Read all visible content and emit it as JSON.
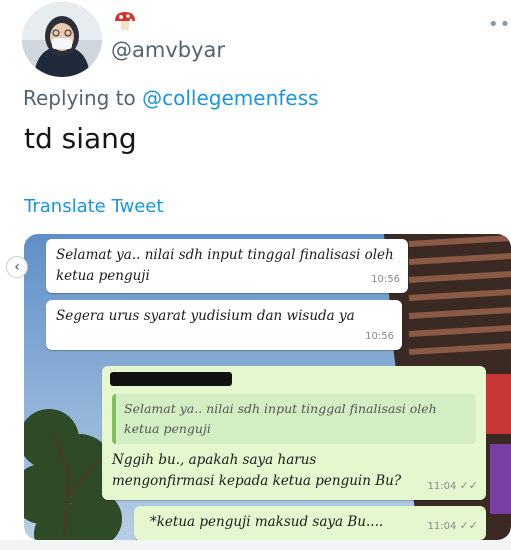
{
  "author": {
    "handle": "@amvbyar",
    "badge_icon": "mushroom-icon",
    "avatar_icon": "avatar"
  },
  "more_icon": "more-icon",
  "reply": {
    "prefix": "Replying to",
    "mention": "@collegemenfess"
  },
  "tweet_text": "td siang",
  "translate_label": "Translate Tweet",
  "chat": {
    "messages": [
      {
        "type": "incoming",
        "text": "Selamat ya.. nilai sdh input tinggal finalisasi oleh ketua penguji",
        "time": "10:56"
      },
      {
        "type": "incoming",
        "text": "Segera urus syarat yudisium dan wisuda ya",
        "time": "10:56"
      },
      {
        "type": "outgoing",
        "quote": "Selamat ya.. nilai sdh input tinggal finalisasi oleh ketua penguji",
        "text": "Nggih bu., apakah saya harus mengonfirmasi kepada ketua penguin Bu?",
        "time": "11:04"
      },
      {
        "type": "outgoing",
        "text": "*ketua penguji maksud saya Bu....",
        "time": "11:04"
      }
    ],
    "read_ticks": "✓✓"
  },
  "colors": {
    "link": "#1b95e0",
    "muted": "#536471",
    "outgoing_bubble": "#e4f7cf"
  }
}
